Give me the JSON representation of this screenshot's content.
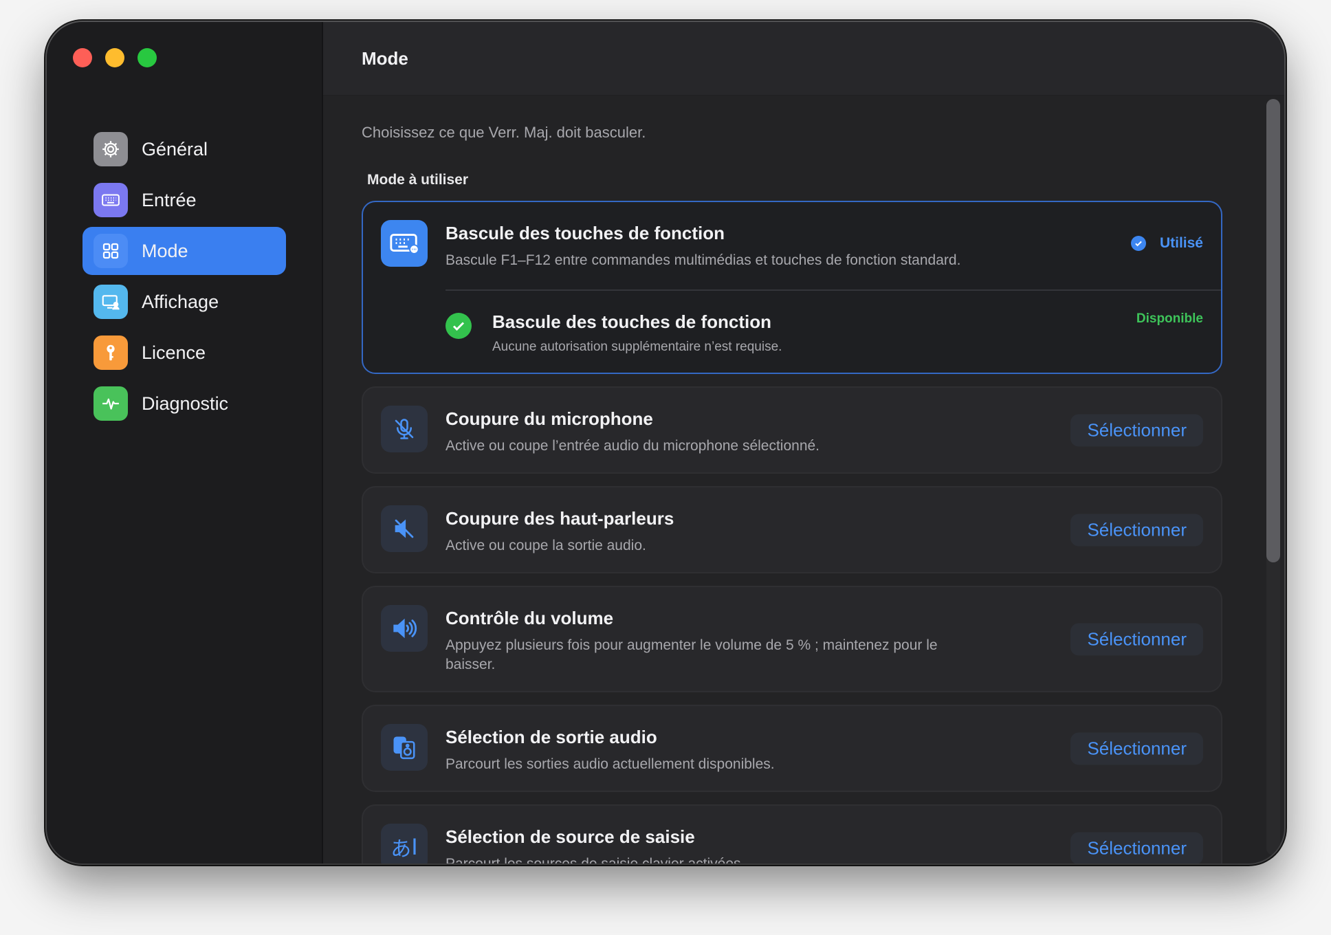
{
  "window": {
    "title": "Mode"
  },
  "sidebar": {
    "items": [
      {
        "label": "Général",
        "icon": "gear-icon",
        "color": "#8e8e93"
      },
      {
        "label": "Entrée",
        "icon": "keyboard-icon",
        "color": "#7b78f0"
      },
      {
        "label": "Mode",
        "icon": "grid-icon",
        "color": "#3a7ff0",
        "active": true
      },
      {
        "label": "Affichage",
        "icon": "display-icon",
        "color": "#54b8ee"
      },
      {
        "label": "Licence",
        "icon": "key-icon",
        "color": "#f89a3a"
      },
      {
        "label": "Diagnostic",
        "icon": "pulse-icon",
        "color": "#49c25a"
      }
    ]
  },
  "main": {
    "subtitle": "Choisissez ce que Verr. Maj. doit basculer.",
    "section_heading": "Mode à utiliser",
    "modes": [
      {
        "title": "Bascule des touches de fonction",
        "desc": "Bascule F1–F12 entre commandes multimédias et touches de fonction standard.",
        "icon": "keyboard-icon",
        "status": "Utilisé",
        "requirement": {
          "title": "Bascule des touches de fonction",
          "desc": "Aucune autorisation supplémentaire n’est requise.",
          "status": "Disponible"
        }
      },
      {
        "title": "Coupure du microphone",
        "desc": "Active ou coupe l’entrée audio du microphone sélectionné.",
        "icon": "mic-slash-icon",
        "action": "Sélectionner"
      },
      {
        "title": "Coupure des haut-parleurs",
        "desc": "Active ou coupe la sortie audio.",
        "icon": "speaker-slash-icon",
        "action": "Sélectionner"
      },
      {
        "title": "Contrôle du volume",
        "desc": "Appuyez plusieurs fois pour augmenter le volume de 5 % ; maintenez pour le baisser.",
        "icon": "speaker-wave-icon",
        "action": "Sélectionner"
      },
      {
        "title": "Sélection de sortie audio",
        "desc": "Parcourt les sorties audio actuellement disponibles.",
        "icon": "speakers-icon",
        "action": "Sélectionner"
      },
      {
        "title": "Sélection de source de saisie",
        "desc": "Parcourt les sources de saisie clavier activées.",
        "icon": "input-source-icon",
        "icon_text": "あ",
        "action": "Sélectionner"
      }
    ]
  },
  "colors": {
    "accent": "#3a7ff0",
    "link": "#4a93f7",
    "success": "#3ec45a"
  }
}
